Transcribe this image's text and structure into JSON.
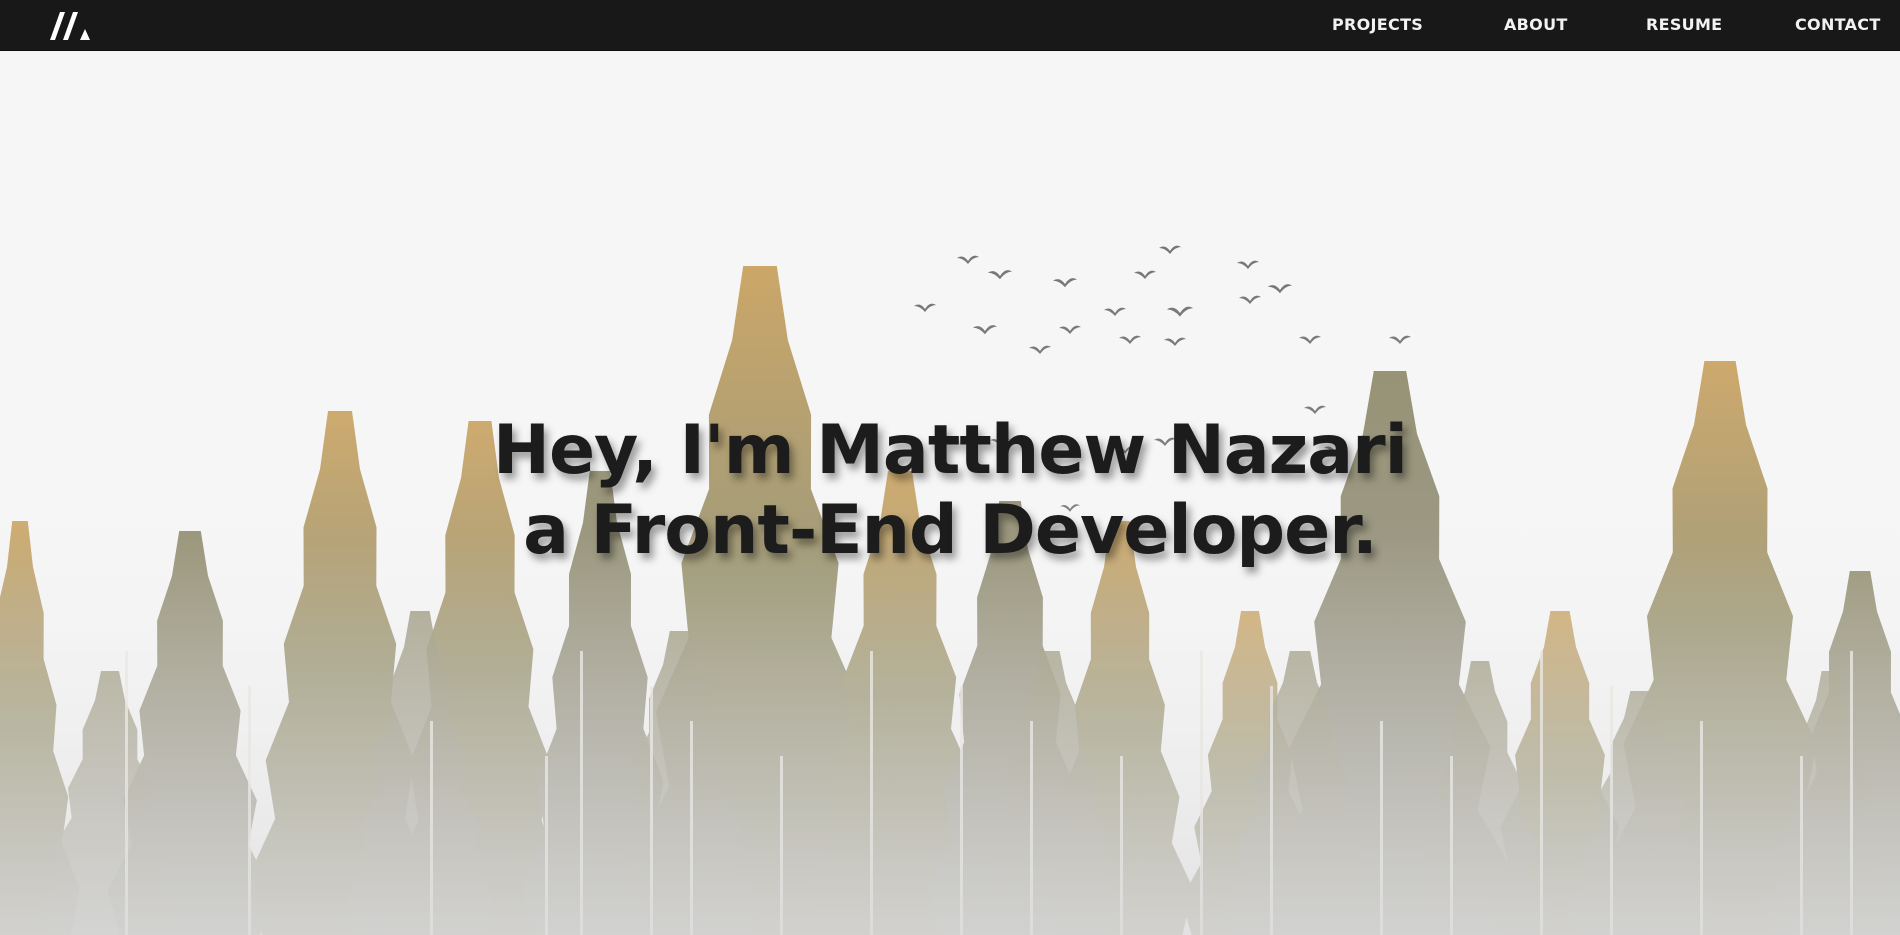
{
  "navbar": {
    "logo_icon": "m-mountain-logo-icon",
    "links": [
      {
        "label": "PROJECTS"
      },
      {
        "label": "ABOUT"
      },
      {
        "label": "RESUME"
      },
      {
        "label": "CONTACT"
      }
    ]
  },
  "hero": {
    "line1": "Hey, I'm Matthew Nazari",
    "line2": "a Front-End Developer.",
    "background_icon": "foggy-pine-forest-with-birds-image",
    "colors": {
      "nav_bg": "#181818",
      "nav_text": "#f2f2f2",
      "title_text": "#1c1c1c",
      "sky": "#f6f6f6",
      "tree_green": "#7f7c5a",
      "tree_gold": "#c59a55"
    }
  }
}
